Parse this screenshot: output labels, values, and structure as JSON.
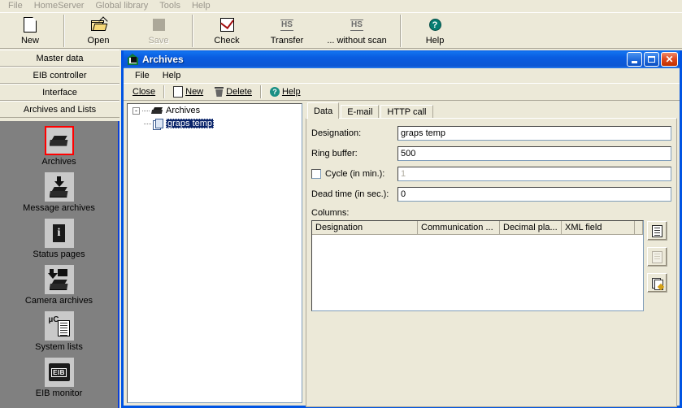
{
  "app": {
    "menu": [
      "File",
      "HomeServer",
      "Global library",
      "Tools",
      "Help"
    ],
    "toolbar": [
      {
        "label": "New",
        "icon": "new-page-icon",
        "disabled": false
      },
      {
        "label": "Open",
        "icon": "open-folder-icon",
        "disabled": false
      },
      {
        "label": "Save",
        "icon": "save-icon",
        "disabled": true
      },
      {
        "label": "Check",
        "icon": "check-icon",
        "disabled": false
      },
      {
        "label": "Transfer",
        "icon": "hs-transfer-icon",
        "disabled": false
      },
      {
        "label": "... without scan",
        "icon": "hs-transfer-icon",
        "disabled": false
      },
      {
        "label": "Help",
        "icon": "help-icon",
        "disabled": false
      }
    ]
  },
  "sidebar": {
    "tabs": [
      "Master data",
      "EIB controller",
      "Interface",
      "Archives and Lists"
    ],
    "active_tab": "Archives and Lists",
    "items": [
      {
        "label": "Archives",
        "icon": "archive-icon",
        "selected": true
      },
      {
        "label": "Message archives",
        "icon": "message-archive-icon",
        "selected": false
      },
      {
        "label": "Status pages",
        "icon": "info-page-icon",
        "selected": false
      },
      {
        "label": "Camera archives",
        "icon": "camera-archive-icon",
        "selected": false
      },
      {
        "label": "System lists",
        "icon": "system-list-icon",
        "selected": false
      },
      {
        "label": "EIB monitor",
        "icon": "eib-monitor-icon",
        "selected": false
      }
    ],
    "selection_color": "#ff0000",
    "background_color": "#808080"
  },
  "window": {
    "title": "Archives",
    "titlebar_color": "#0a5ce0",
    "controls": {
      "minimize": "minimize-button",
      "maximize": "maximize-button",
      "close": "close-button"
    },
    "menu": [
      "File",
      "Help"
    ],
    "toolbar": [
      {
        "label": "Close",
        "accel": "C",
        "icon": null
      },
      {
        "label": "New",
        "accel": "N",
        "icon": "new-page-icon"
      },
      {
        "label": "Delete",
        "accel": "D",
        "icon": "trash-icon"
      },
      {
        "label": "Help",
        "accel": "H",
        "icon": "help-icon"
      }
    ]
  },
  "tree": {
    "root": {
      "label": "Archives",
      "expanded": true,
      "expander": "-"
    },
    "children": [
      {
        "label": "graps temp",
        "selected": true
      }
    ]
  },
  "tabs": {
    "items": [
      "Data",
      "E-mail",
      "HTTP call"
    ],
    "active": "Data"
  },
  "form": {
    "designation": {
      "label": "Designation:",
      "value": "graps temp"
    },
    "ring_buffer": {
      "label": "Ring buffer:",
      "value": "500"
    },
    "cycle": {
      "label": "Cycle (in min.):",
      "value": "1",
      "checked": false,
      "enabled": false
    },
    "dead_time": {
      "label": "Dead time (in sec.):",
      "value": "0"
    },
    "columns_label": "Columns:"
  },
  "columns_grid": {
    "headers": [
      "Designation",
      "Communication ...",
      "Decimal pla...",
      "XML field",
      ""
    ],
    "rows": []
  },
  "side_buttons": [
    {
      "name": "new-column-button",
      "icon": "document-icon",
      "disabled": false
    },
    {
      "name": "copy-column-button",
      "icon": "copy-document-icon",
      "disabled": true
    },
    {
      "name": "edit-column-button",
      "icon": "edit-document-icon",
      "disabled": false
    }
  ]
}
